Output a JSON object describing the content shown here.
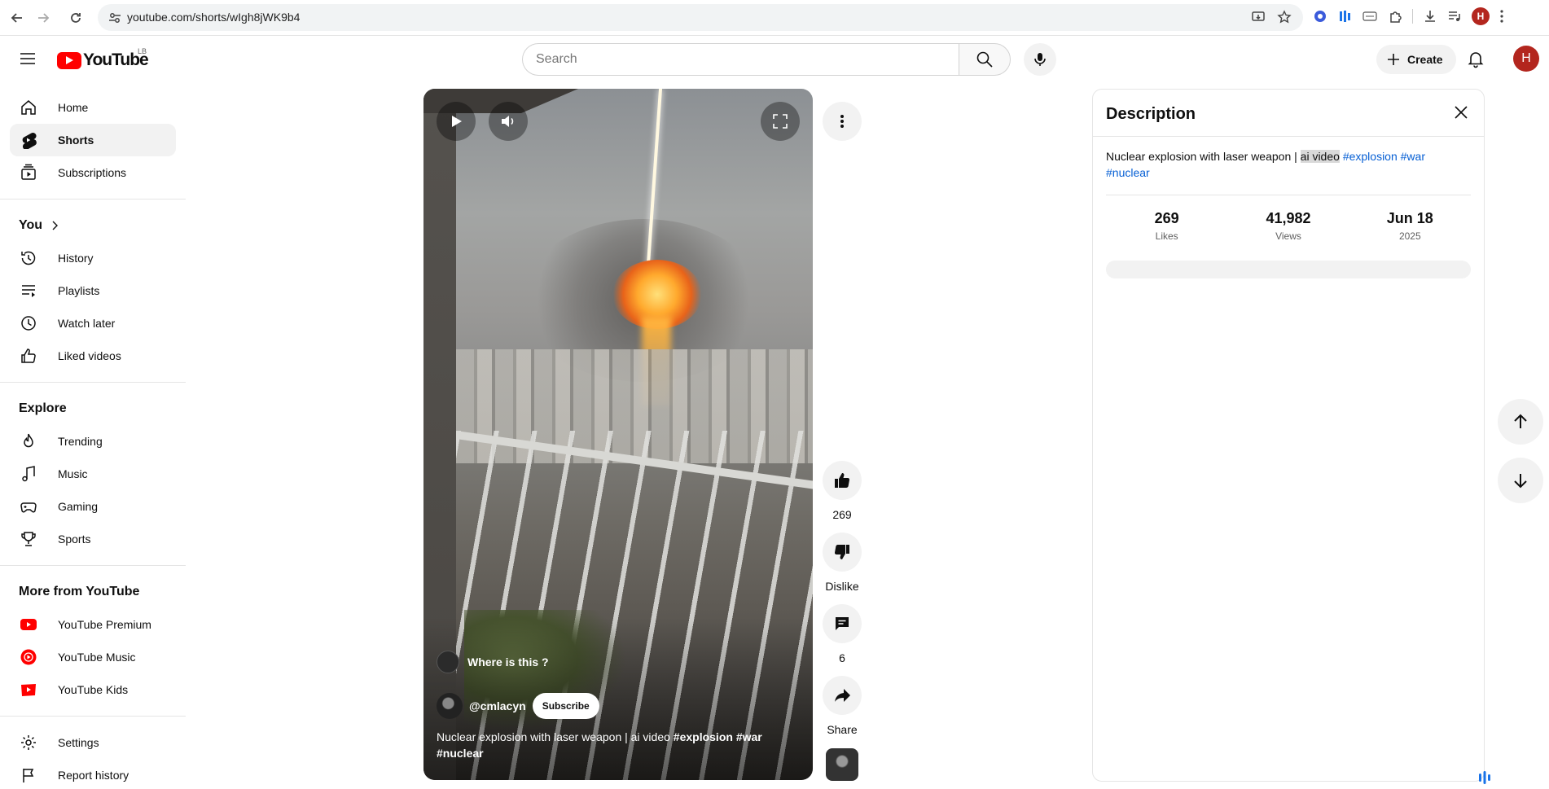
{
  "browser": {
    "url": "youtube.com/shorts/wIgh8jWK9b4",
    "avatar_letter": "H"
  },
  "masthead": {
    "logo_text": "YouTube",
    "country_code": "LB",
    "search_placeholder": "Search",
    "create_label": "Create",
    "avatar_letter": "H"
  },
  "sidebar": {
    "main": [
      {
        "label": "Home",
        "icon": "home-icon"
      },
      {
        "label": "Shorts",
        "icon": "shorts-icon",
        "active": true
      },
      {
        "label": "Subscriptions",
        "icon": "subscriptions-icon"
      }
    ],
    "you_heading": "You",
    "you": [
      {
        "label": "History",
        "icon": "history-icon"
      },
      {
        "label": "Playlists",
        "icon": "playlists-icon"
      },
      {
        "label": "Watch later",
        "icon": "watch-later-icon"
      },
      {
        "label": "Liked videos",
        "icon": "liked-videos-icon"
      }
    ],
    "explore_heading": "Explore",
    "explore": [
      {
        "label": "Trending",
        "icon": "trending-icon"
      },
      {
        "label": "Music",
        "icon": "music-icon"
      },
      {
        "label": "Gaming",
        "icon": "gaming-icon"
      },
      {
        "label": "Sports",
        "icon": "sports-icon"
      }
    ],
    "more_heading": "More from YouTube",
    "more": [
      {
        "label": "YouTube Premium",
        "icon": "youtube-premium-icon"
      },
      {
        "label": "YouTube Music",
        "icon": "youtube-music-icon"
      },
      {
        "label": "YouTube Kids",
        "icon": "youtube-kids-icon"
      }
    ],
    "footer": [
      {
        "label": "Settings",
        "icon": "settings-icon"
      },
      {
        "label": "Report history",
        "icon": "report-flag-icon"
      }
    ]
  },
  "short": {
    "pivot_text": "Where is this ?",
    "channel": "@cmlacyn",
    "subscribe_label": "Subscribe",
    "title_text": "Nuclear explosion with laser weapon | ai video ",
    "title_tags_line1": "#explosion #war",
    "title_tags_line2": "#nuclear"
  },
  "actions": {
    "like_count": "269",
    "dislike_label": "Dislike",
    "comment_count": "6",
    "share_label": "Share"
  },
  "description": {
    "heading": "Description",
    "text_prefix": "Nuclear explosion with laser weapon | ",
    "text_highlight": "ai video",
    "tag1": "#explosion",
    "tag2": "#war",
    "tag3": "#nuclear",
    "stats": [
      {
        "value": "269",
        "label": "Likes"
      },
      {
        "value": "41,982",
        "label": "Views"
      },
      {
        "value": "Jun 18",
        "label": "2025"
      }
    ]
  },
  "colors": {
    "brand_red": "#ff0000",
    "link_blue": "#065fd4",
    "avatar_red": "#b3261e"
  }
}
